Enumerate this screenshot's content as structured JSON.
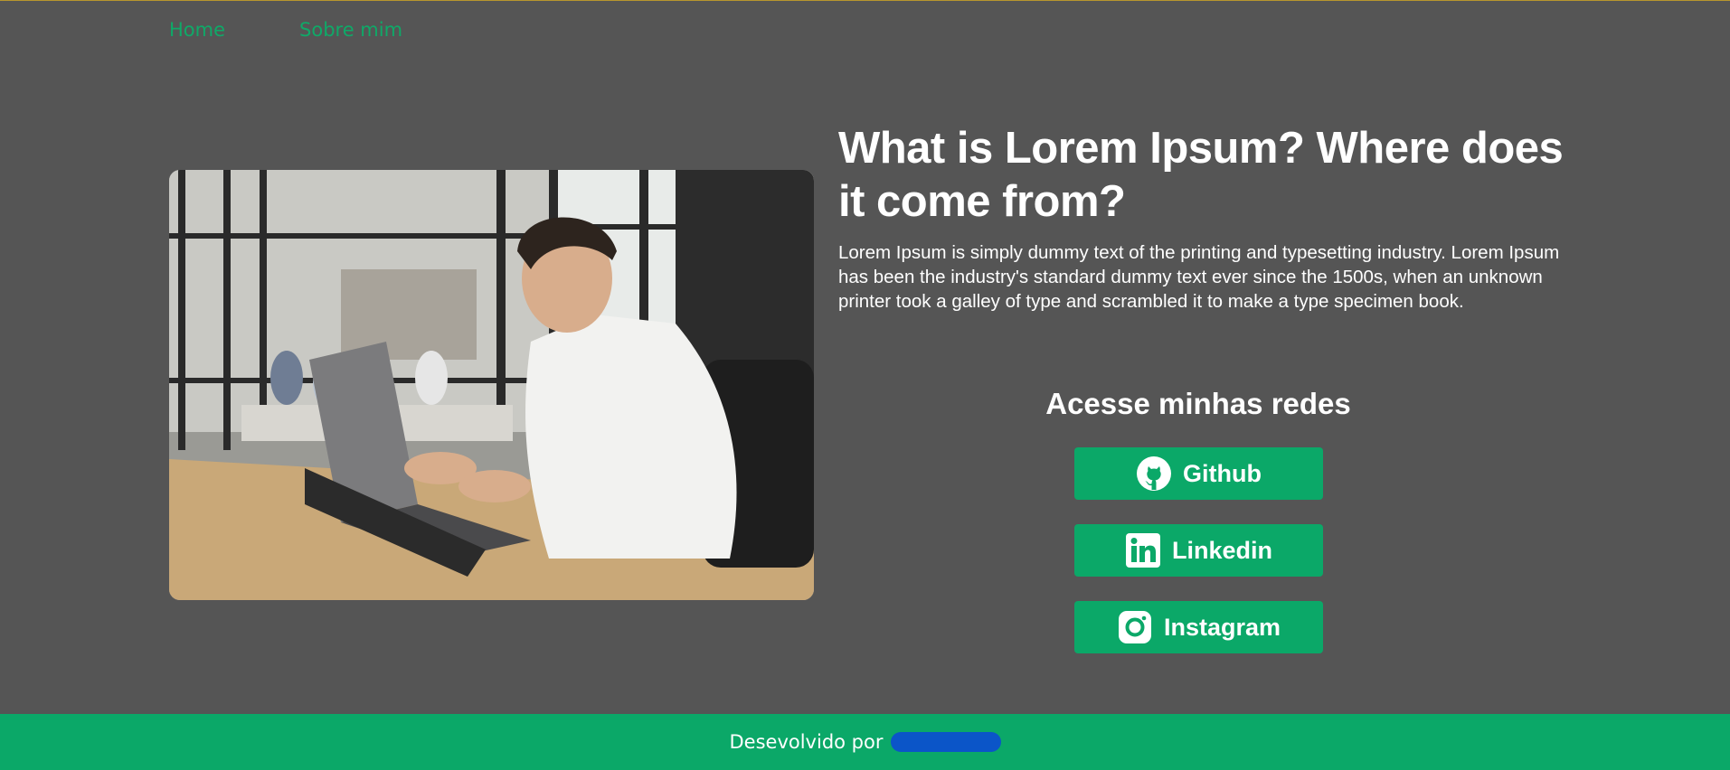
{
  "nav": {
    "home": "Home",
    "about": "Sobre mim"
  },
  "hero": {
    "title": "What is Lorem Ipsum? Where does it come from?",
    "description": "Lorem Ipsum is simply dummy text of the printing and typesetting industry. Lorem Ipsum has been the industry's standard dummy text ever since the 1500s, when an unknown printer took a galley of type and scrambled it to make a type specimen book."
  },
  "social": {
    "title": "Acesse minhas redes",
    "buttons": [
      {
        "label": "Github",
        "icon": "github-icon"
      },
      {
        "label": "Linkedin",
        "icon": "linkedin-icon"
      },
      {
        "label": "Instagram",
        "icon": "instagram-icon"
      }
    ]
  },
  "footer": {
    "text": "Desevolvido por"
  },
  "colors": {
    "accent": "#0ba868",
    "background": "#555555",
    "nav_link": "#0fa968"
  }
}
